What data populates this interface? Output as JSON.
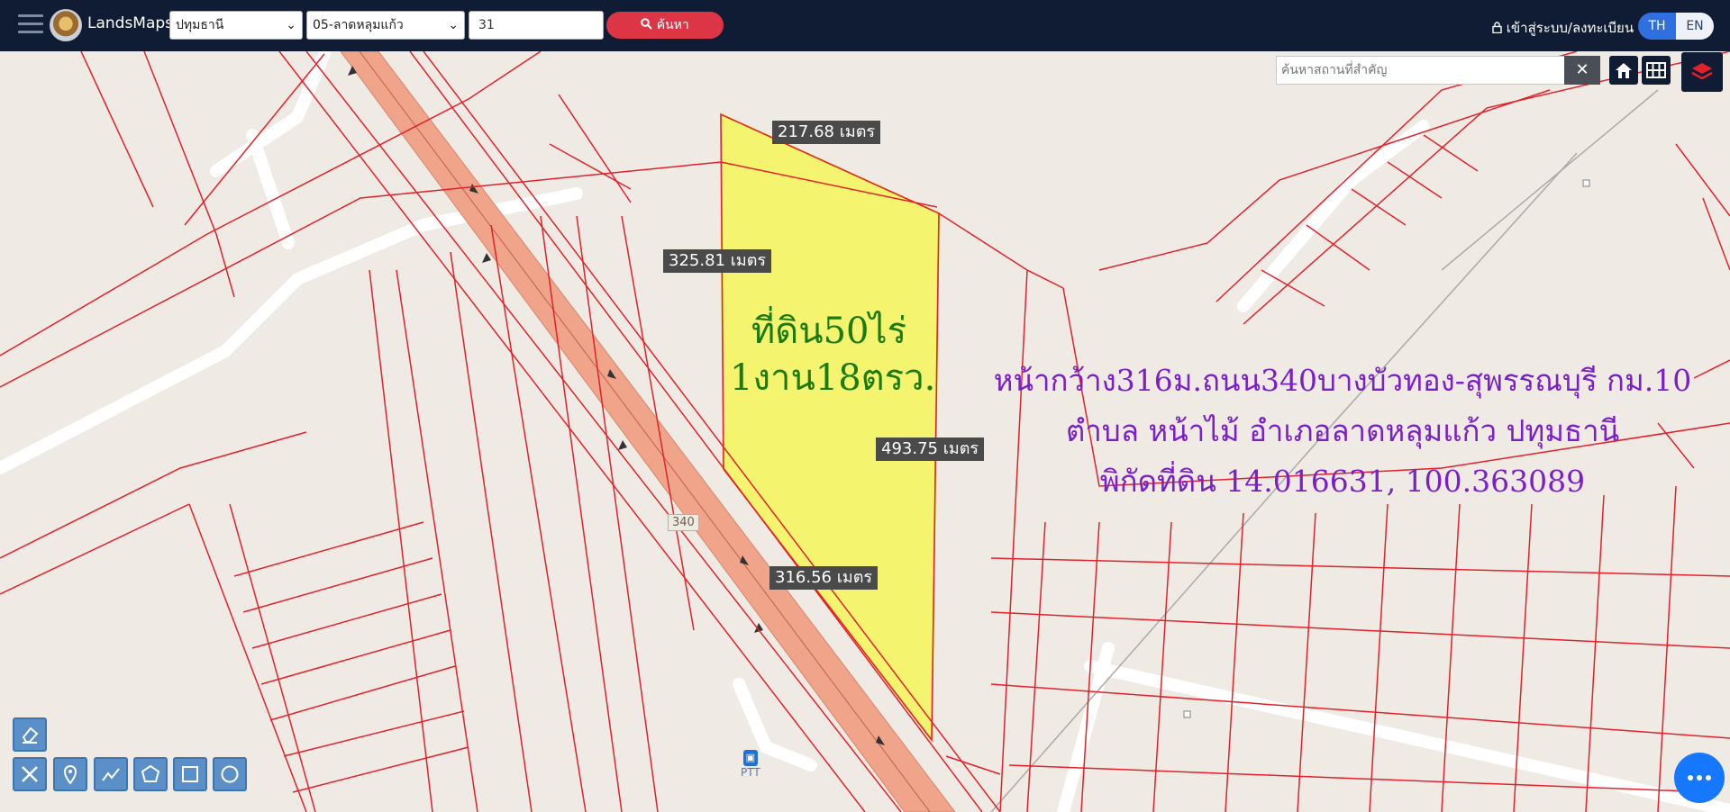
{
  "header": {
    "brand": "LandsMaps",
    "province": "ปทุมธานี",
    "district": "05-ลาดหลุมแก้ว",
    "parcel_no": "31",
    "search_label": "ค้นหา",
    "login_label": "เข้าสู่ระบบ/ลงทะเบียน",
    "lang_th": "TH",
    "lang_en": "EN"
  },
  "map": {
    "place_search_placeholder": "ค้นหาสถานที่สำคัญ",
    "clear_label": "✕",
    "measurements": {
      "top": "217.68 เมตร",
      "left": "325.81 เมตร",
      "right": "493.75 เมตร",
      "bottom": "316.56 เมตร"
    },
    "land_label_line1": "ที่ดิน50ไร่",
    "land_label_line2": "1งาน18ตรว.",
    "note_line1": "หน้ากว้าง316ม.ถนน340บางบัวทอง-สุพรรณบุรี กม.10",
    "note_line2": "ตำบล หน้าไม้ อำเภอลาดหลุมแก้ว ปทุมธานี",
    "note_line3": "พิกัดที่ดิน 14.016631, 100.363089",
    "road_number": "340",
    "poi_label": "PTT",
    "colors": {
      "parcel_fill": "#f5f46e",
      "parcel_lines": "#e4202a",
      "highway": "#f0a58a",
      "note_text": "#7b1fc9",
      "land_label": "#1b7a10"
    }
  },
  "tools": [
    "eraser-icon",
    "measure-icon",
    "pin-icon",
    "polyline-icon",
    "polygon-icon",
    "rectangle-icon",
    "circle-icon"
  ]
}
